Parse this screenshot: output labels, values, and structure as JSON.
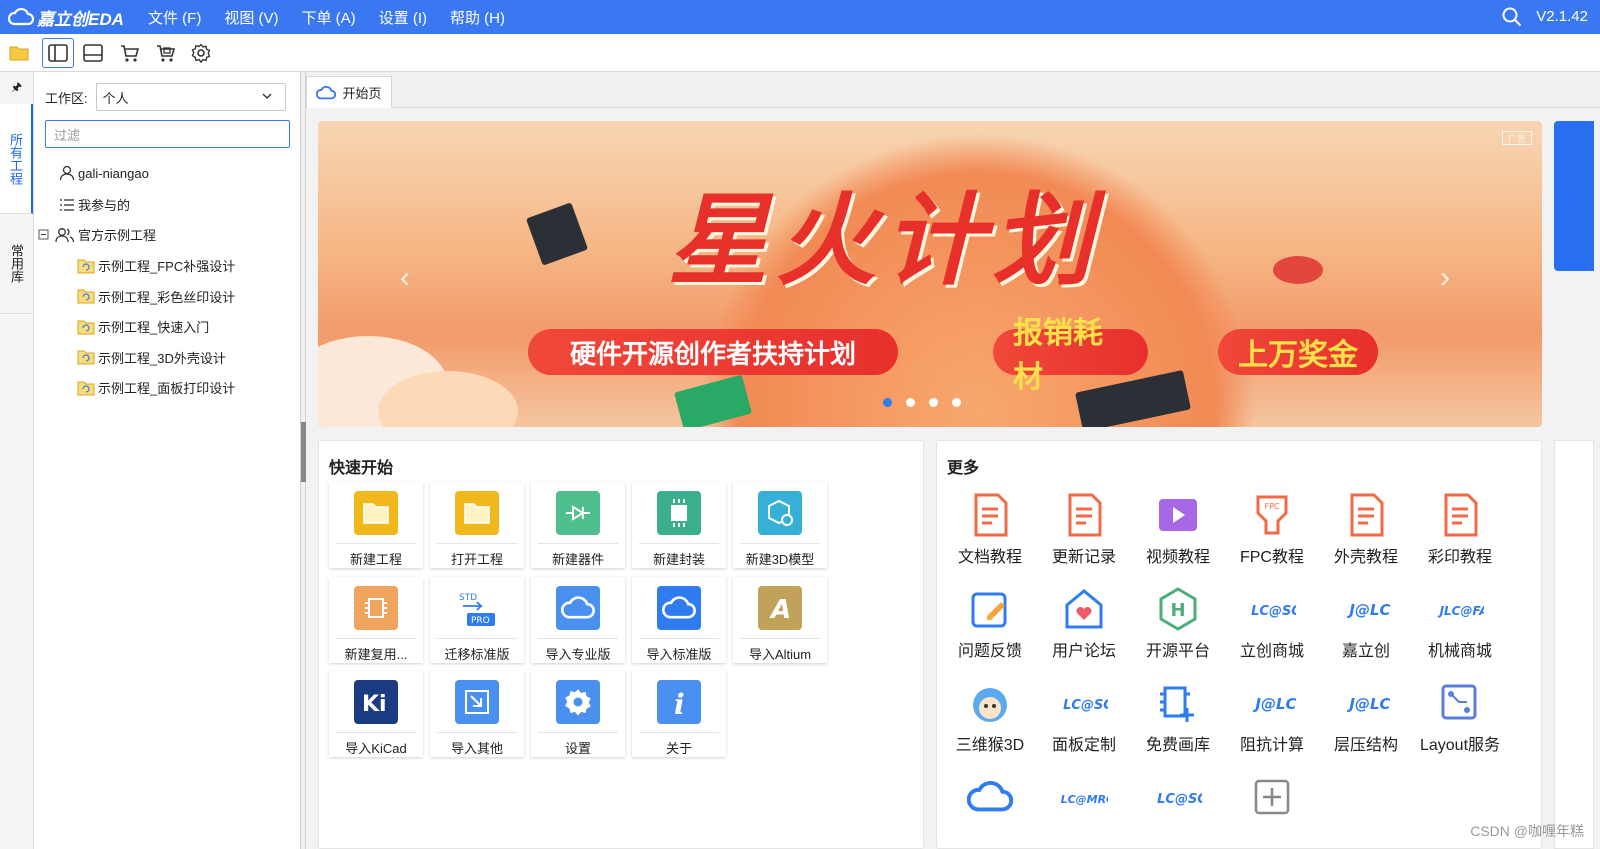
{
  "menubar": {
    "logo": "嘉立创EDA",
    "items": [
      "文件 (F)",
      "视图 (V)",
      "下单 (A)",
      "设置 (I)",
      "帮助 (H)"
    ],
    "version": "V2.1.42",
    "accent": "#3a78f2"
  },
  "toolbar": {
    "icons": [
      "folder-icon",
      "left-panel-icon",
      "bottom-panel-icon",
      "cart-icon",
      "order-icon",
      "settings-icon"
    ]
  },
  "left_tabs": {
    "pin": "🖈",
    "all_projects": "所有工程",
    "common_lib": "常用库"
  },
  "panel": {
    "workspace_label": "工作区:",
    "workspace_value": "个人",
    "filter_placeholder": "过滤",
    "tree": {
      "user": "gali-niangao",
      "participated": "我参与的",
      "official": "官方示例工程",
      "examples": [
        "示例工程_FPC补强设计",
        "示例工程_彩色丝印设计",
        "示例工程_快速入门",
        "示例工程_3D外壳设计",
        "示例工程_面板打印设计"
      ]
    }
  },
  "tabs": {
    "start": "开始页"
  },
  "banner": {
    "title": "星火计划",
    "pill1": "硬件开源创作者扶持计划",
    "pill2": "报销耗材",
    "pill3": "上万奖金",
    "ad": "广告",
    "prev": "‹",
    "next": "›"
  },
  "quick_start": {
    "title": "快速开始",
    "items": [
      {
        "label": "新建工程",
        "icon": "folder-icon"
      },
      {
        "label": "打开工程",
        "icon": "folder-open-icon"
      },
      {
        "label": "新建器件",
        "icon": "component-icon"
      },
      {
        "label": "新建封装",
        "icon": "footprint-icon"
      },
      {
        "label": "新建3D模型",
        "icon": "3d-model-icon"
      },
      {
        "label": "新建复用...",
        "icon": "reuse-icon"
      },
      {
        "label": "迁移标准版",
        "icon": "migrate-icon"
      },
      {
        "label": "导入专业版",
        "icon": "import-pro-icon"
      },
      {
        "label": "导入标准版",
        "icon": "import-std-icon"
      },
      {
        "label": "导入Altium",
        "icon": "altium-icon"
      },
      {
        "label": "导入KiCad",
        "icon": "kicad-icon"
      },
      {
        "label": "导入其他",
        "icon": "import-more-icon"
      },
      {
        "label": "设置",
        "icon": "gear-icon"
      },
      {
        "label": "关于",
        "icon": "info-icon"
      }
    ]
  },
  "more": {
    "title": "更多",
    "items": [
      {
        "label": "文档教程",
        "icon": "doc-icon"
      },
      {
        "label": "更新记录",
        "icon": "changelog-icon"
      },
      {
        "label": "视频教程",
        "icon": "video-icon"
      },
      {
        "label": "FPC教程",
        "icon": "fpc-icon"
      },
      {
        "label": "外壳教程",
        "icon": "shell-doc-icon"
      },
      {
        "label": "彩印教程",
        "icon": "color-print-doc-icon"
      },
      {
        "label": "问题反馈",
        "icon": "feedback-icon"
      },
      {
        "label": "用户论坛",
        "icon": "forum-icon"
      },
      {
        "label": "开源平台",
        "icon": "oshw-icon"
      },
      {
        "label": "立创商城",
        "icon": "lcsc-icon"
      },
      {
        "label": "嘉立创",
        "icon": "jlc-icon"
      },
      {
        "label": "机械商城",
        "icon": "jlcfa-icon"
      },
      {
        "label": "三维猴3D",
        "icon": "monkey-3d-icon"
      },
      {
        "label": "面板定制",
        "icon": "panel-custom-icon"
      },
      {
        "label": "免费画库",
        "icon": "free-lib-icon"
      },
      {
        "label": "阻抗计算",
        "icon": "impedance-icon"
      },
      {
        "label": "层压结构",
        "icon": "stackup-icon"
      },
      {
        "label": "Layout服务",
        "icon": "layout-service-icon"
      },
      {
        "label": "",
        "icon": "cloud-eda-icon"
      },
      {
        "label": "",
        "icon": "lcmro-icon"
      },
      {
        "label": "",
        "icon": "lcsc-icon"
      },
      {
        "label": "",
        "icon": "add-icon"
      }
    ]
  },
  "watermark": "CSDN @咖喱年糕"
}
